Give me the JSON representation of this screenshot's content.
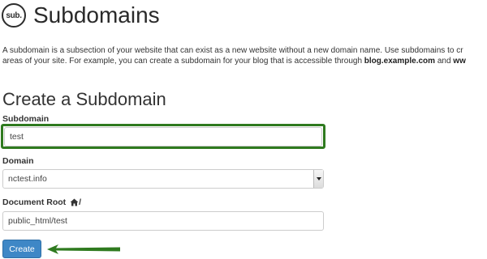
{
  "header": {
    "logo_text": "sub.",
    "title": "Subdomains"
  },
  "description": {
    "line1": "A subdomain is a subsection of your website that can exist as a new website without a new domain name. Use subdomains to cr",
    "line2_before": "areas of your site. For example, you can create a subdomain for your blog that is accessible through ",
    "line2_bold1": "blog.example.com",
    "line2_middle": " and ",
    "line2_bold2": "ww"
  },
  "form": {
    "section_title": "Create a Subdomain",
    "subdomain": {
      "label": "Subdomain",
      "value": "test"
    },
    "domain": {
      "label": "Domain",
      "selected": "nctest.info"
    },
    "document_root": {
      "label": "Document Root",
      "suffix": "/",
      "value": "public_html/test"
    },
    "submit_label": "Create"
  },
  "colors": {
    "highlight": "#2f7a1f",
    "button": "#3e87c6"
  },
  "icons": {
    "logo": "sub-logo-icon",
    "home": "home-icon",
    "dropdown": "chevron-down-icon",
    "annotation_arrow": "arrow-left-icon"
  }
}
